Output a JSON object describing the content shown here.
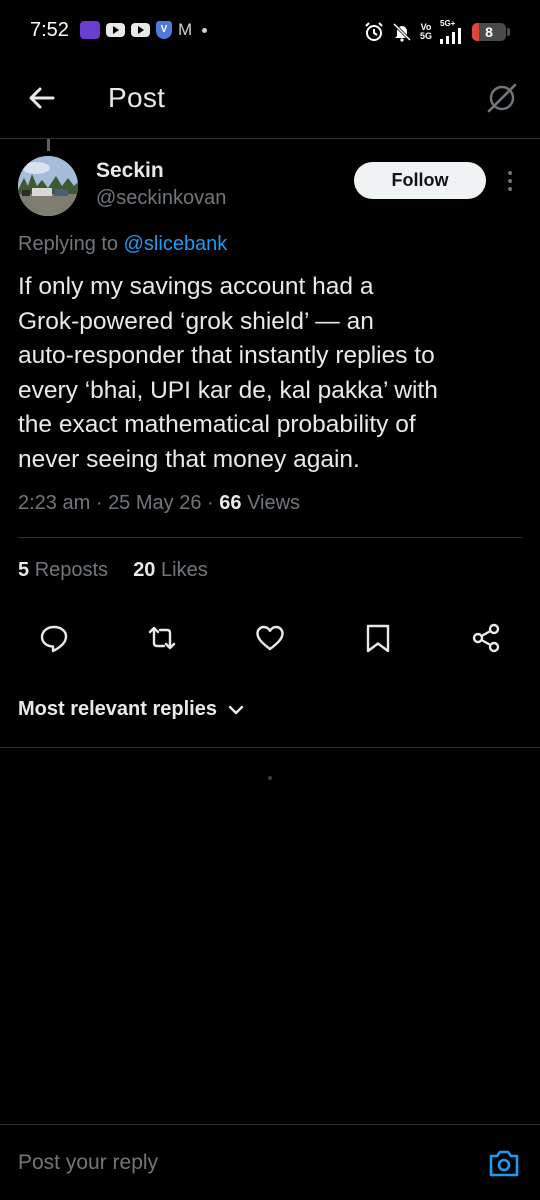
{
  "status_bar": {
    "time": "7:52",
    "notifications": [
      "zomato-icon",
      "youtube-icon",
      "youtube-icon",
      "shield-icon",
      "gmail-icon",
      "more-dot"
    ],
    "network": {
      "top": "Vo",
      "bottom": "5G",
      "type": "5G+"
    },
    "battery": "8"
  },
  "header": {
    "title": "Post",
    "back_icon": "arrow-left-icon",
    "grok_icon": "grok-icon"
  },
  "post": {
    "author": {
      "display_name": "Seckin",
      "handle": "@seckinkovan"
    },
    "follow_label": "Follow",
    "replying_prefix": "Replying to",
    "replying_to": "@slicebank",
    "text": "If only my savings account had a\nGrok-powered ‘grok shield’ — an\nauto-responder that instantly replies to\nevery ‘bhai, UPI kar de, kal pakka’ with\nthe exact mathematical probability of\nnever seeing that money again.",
    "time": "2:23 am",
    "date": "25 May 26",
    "views_count": "66",
    "views_label": "Views",
    "reposts_count": "5",
    "reposts_label": "Reposts",
    "likes_count": "20",
    "likes_label": "Likes"
  },
  "actions": [
    "reply-icon",
    "repost-icon",
    "like-icon",
    "bookmark-icon",
    "share-icon"
  ],
  "replies": {
    "sort_label": "Most relevant replies"
  },
  "reply_bar": {
    "placeholder": "Post your reply"
  },
  "colors": {
    "background": "#000000",
    "text": "#e7e9ea",
    "secondary": "#71767b",
    "accent": "#1d9bf0",
    "divider": "#2f3336"
  }
}
